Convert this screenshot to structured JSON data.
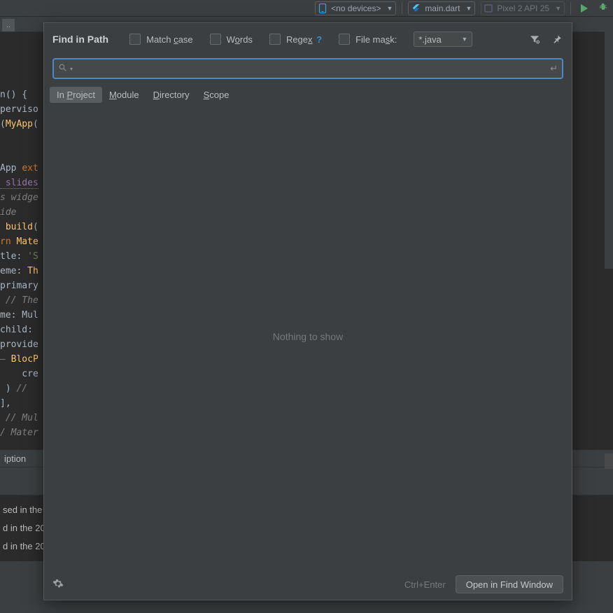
{
  "toolbar": {
    "device_label": "<no devices>",
    "config_label": "main.dart",
    "avd_label": "Pixel 2 API 25"
  },
  "editor": {
    "l1": "n() {",
    "l2": "perviso",
    "l3_open": "(",
    "l3_call": "MyApp",
    "l3_close": "(",
    "l5": "App ",
    "l5_kw": "ext",
    "l6_idn": " slides",
    "l7": "s widge",
    "l8": "ide",
    "l9_fn": " build",
    "l9_paren": "(",
    "l10_kw": "rn ",
    "l10_cls": "Mate",
    "l11": "tle: ",
    "l11_str": "'S",
    "l12": "eme: ",
    "l12_cls": "Th",
    "l13": "primary",
    "l14_cmt": " // The",
    "l15": "me: Mul",
    "l16": "child:",
    "l17": "provide",
    "l18_dash": "— ",
    "l18_cls": "BlocP",
    "l19": "    cre",
    "l20": " ) ",
    "l20_cmt": "// ",
    "l21": "],",
    "l22_cmt": " // Mul",
    "l23_cmt": "/ Mater"
  },
  "bottom": {
    "header": "iption",
    "line1": "sed in the",
    "line2": "d in the 20",
    "line3": "d in the 20"
  },
  "dialog": {
    "title": "Find in Path",
    "match_case": "Match case",
    "words": "Words",
    "regex": "Regex",
    "file_mask": "File mask:",
    "mask_value": "*.java",
    "search_value": "",
    "tabs": {
      "project": "In Project",
      "module": "Module",
      "directory": "Directory",
      "scope": "Scope"
    },
    "empty": "Nothing to show",
    "hint": "Ctrl+Enter",
    "open_btn": "Open in Find Window"
  },
  "sec_tab": ".."
}
